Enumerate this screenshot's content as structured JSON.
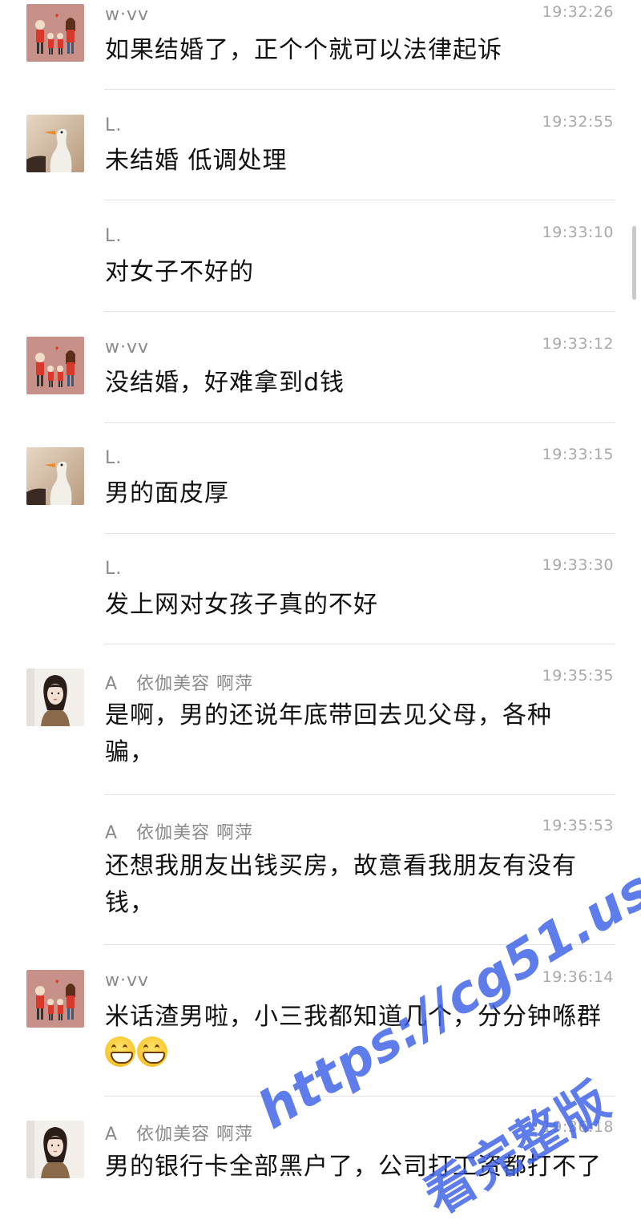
{
  "messages": [
    {
      "sender": "w·vv",
      "avatar": "family-cartoon",
      "time": "19:32:26",
      "text": "如果结婚了，正个个就可以法律起诉"
    },
    {
      "sender": "L.",
      "avatar": "goose-photo",
      "time": "19:32:55",
      "text": "未结婚 低调处理"
    },
    {
      "sender": "L.",
      "avatar": "",
      "time": "19:33:10",
      "text": "对女子不好的"
    },
    {
      "sender": "w·vv",
      "avatar": "family-cartoon",
      "time": "19:33:12",
      "text": "没结婚，好难拿到d钱"
    },
    {
      "sender": "L.",
      "avatar": "goose-photo",
      "time": "19:33:15",
      "text": "男的面皮厚"
    },
    {
      "sender": "L.",
      "avatar": "",
      "time": "19:33:30",
      "text": "发上网对女孩子真的不好"
    },
    {
      "sender": "A　依伽美容 啊萍",
      "avatar": "woman-photo",
      "time": "19:35:35",
      "text": "是啊，男的还说年底带回去见父母，各种骗，"
    },
    {
      "sender": "A　依伽美容 啊萍",
      "avatar": "",
      "time": "19:35:53",
      "text": "还想我朋友出钱买房，故意看我朋友有没有钱，"
    },
    {
      "sender": "w·vv",
      "avatar": "family-cartoon",
      "time": "19:36:14",
      "text": "米话渣男啦，小三我都知道几个，分分钟喺群",
      "emoji": "grinning-face-icon"
    },
    {
      "sender": "A　依伽美容 啊萍",
      "avatar": "woman-photo",
      "time": "19:36:18",
      "text": "男的银行卡全部黑户了，公司打工资都打不了"
    }
  ],
  "watermark": {
    "url": "https://cg51.us",
    "caption": "看完整版"
  }
}
